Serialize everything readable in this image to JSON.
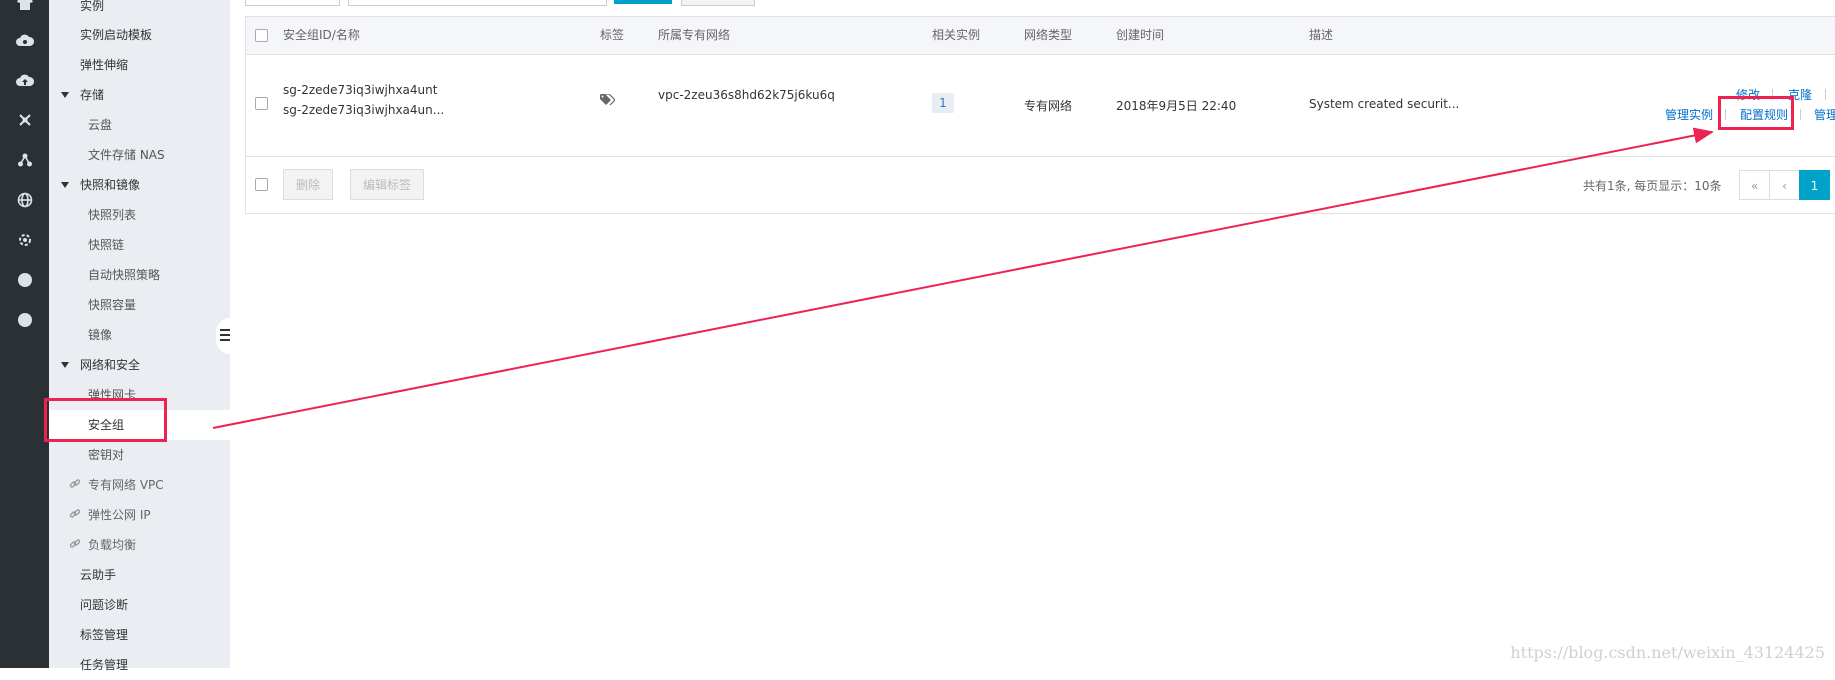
{
  "sidebar": {
    "items": [
      {
        "label": "实例",
        "type": "level1"
      },
      {
        "label": "实例启动模板",
        "type": "level1"
      },
      {
        "label": "弹性伸缩",
        "type": "level1"
      },
      {
        "label": "存储",
        "type": "group"
      },
      {
        "label": "云盘",
        "type": "level2"
      },
      {
        "label": "文件存储 NAS",
        "type": "level2"
      },
      {
        "label": "快照和镜像",
        "type": "group"
      },
      {
        "label": "快照列表",
        "type": "level2"
      },
      {
        "label": "快照链",
        "type": "level2"
      },
      {
        "label": "自动快照策略",
        "type": "level2"
      },
      {
        "label": "快照容量",
        "type": "level2"
      },
      {
        "label": "镜像",
        "type": "level2"
      },
      {
        "label": "网络和安全",
        "type": "group"
      },
      {
        "label": "弹性网卡",
        "type": "level2"
      },
      {
        "label": "安全组",
        "type": "level2",
        "active": true
      },
      {
        "label": "密钥对",
        "type": "level2"
      },
      {
        "label": "专有网络 VPC",
        "type": "ext"
      },
      {
        "label": "弹性公网 IP",
        "type": "ext"
      },
      {
        "label": "负载均衡",
        "type": "ext"
      },
      {
        "label": "云助手",
        "type": "level1"
      },
      {
        "label": "问题诊断",
        "type": "level1"
      },
      {
        "label": "标签管理",
        "type": "level1"
      },
      {
        "label": "任务管理",
        "type": "level1"
      }
    ]
  },
  "table": {
    "headers": {
      "id_name": "安全组ID/名称",
      "tags": "标签",
      "vpc": "所属专有网络",
      "instances": "相关实例",
      "network_type": "网络类型",
      "created": "创建时间",
      "description": "描述"
    },
    "rows": [
      {
        "id": "sg-2zede73iq3iwjhxa4unt",
        "name": "sg-2zede73iq3iwjhxa4un...",
        "vpc": "vpc-2zeu36s8hd62k75j6ku6q",
        "instances": "1",
        "network_type": "专有网络",
        "created": "2018年9月5日 22:40",
        "description": "System created securit...",
        "actions": {
          "edit": "修改",
          "clone": "克隆",
          "manage_instances": "管理实例",
          "configure_rules": "配置规则",
          "manage_cut": "管理"
        }
      }
    ],
    "footer": {
      "delete": "删除",
      "edit_tags": "编辑标签",
      "pager_info": "共有1条, 每页显示：10条",
      "first": "«",
      "prev": "‹",
      "current_page": "1"
    }
  },
  "watermark": "https://blog.csdn.net/weixin_43124425",
  "colors": {
    "accent": "#00a2ca",
    "link": "#0070cc",
    "highlight": "#ee2251",
    "rail": "#2b3035",
    "sidenav": "#eaedf1"
  }
}
